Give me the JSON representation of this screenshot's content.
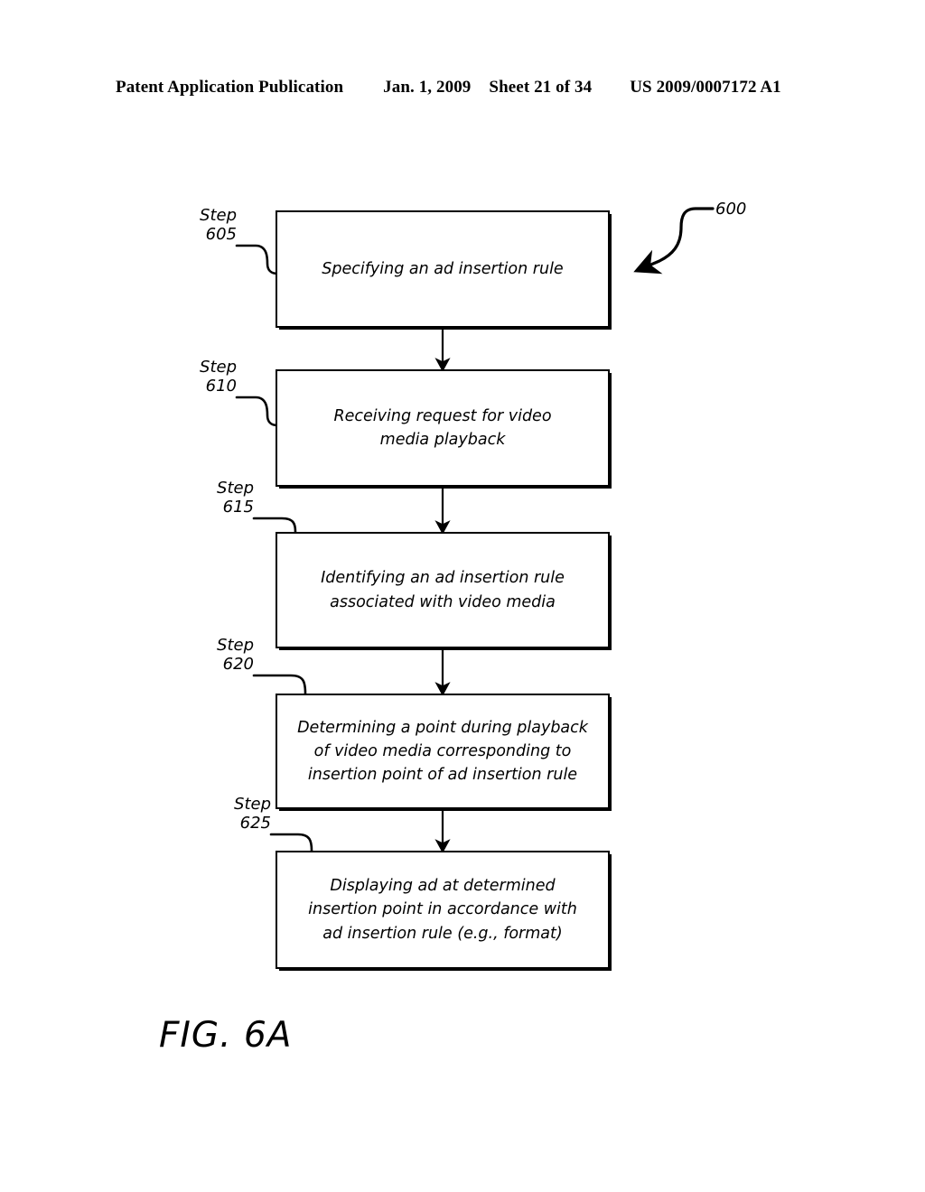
{
  "header": {
    "publication": "Patent Application Publication",
    "date": "Jan. 1, 2009",
    "sheet": "Sheet 21 of 34",
    "patent_number": "US 2009/0007172 A1"
  },
  "figure": {
    "caption": "FIG. 6A",
    "reference_numeral": "600"
  },
  "flowchart": {
    "steps": [
      {
        "step_word": "Step",
        "step_number": "605",
        "label": "Step\n605",
        "text": "Specifying an ad insertion rule"
      },
      {
        "step_word": "Step",
        "step_number": "610",
        "label": "Step\n610",
        "text": "Receiving request for video\nmedia playback"
      },
      {
        "step_word": "Step",
        "step_number": "615",
        "label": "Step\n615",
        "text": "Identifying an ad insertion rule\nassociated with video media"
      },
      {
        "step_word": "Step",
        "step_number": "620",
        "label": "Step\n620",
        "text": "Determining a point during playback\nof video media corresponding to\ninsertion point of ad insertion rule"
      },
      {
        "step_word": "Step",
        "step_number": "625",
        "label": "Step\n625",
        "text": "Displaying ad at determined\ninsertion point in accordance with\nad insertion rule (e.g., format)"
      }
    ]
  },
  "colors": {
    "ink": "#000000",
    "page": "#ffffff"
  }
}
